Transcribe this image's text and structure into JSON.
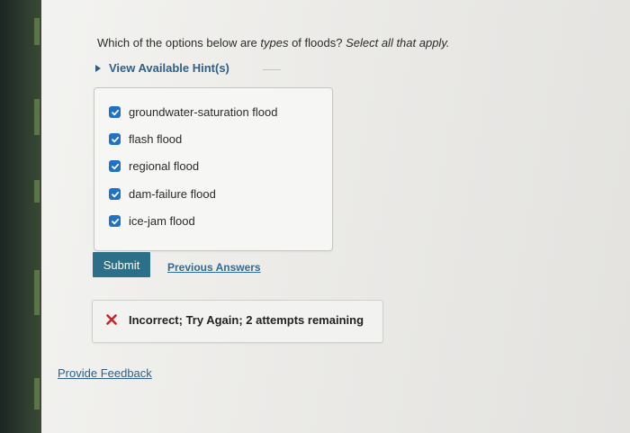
{
  "question": {
    "text_part1": "Which of the options below are ",
    "text_em1": "types",
    "text_part2": " of floods? ",
    "text_em2": "Select all that apply."
  },
  "hint": {
    "label": "View Available Hint(s)"
  },
  "options": [
    {
      "label": "groundwater-saturation flood",
      "checked": true
    },
    {
      "label": "flash flood",
      "checked": true
    },
    {
      "label": "regional flood",
      "checked": true
    },
    {
      "label": "dam-failure flood",
      "checked": true
    },
    {
      "label": "ice-jam flood",
      "checked": true
    }
  ],
  "actions": {
    "submit_label": "Submit",
    "previous_answers_label": "Previous Answers"
  },
  "result": {
    "message": "Incorrect; Try Again; 2 attempts remaining"
  },
  "footer": {
    "provide_feedback_label": "Provide Feedback"
  },
  "colors": {
    "checkbox_blue": "#1f72c8",
    "submit_teal": "#2b6f88",
    "link_blue": "#2f5f88",
    "incorrect_red": "#c62828"
  }
}
